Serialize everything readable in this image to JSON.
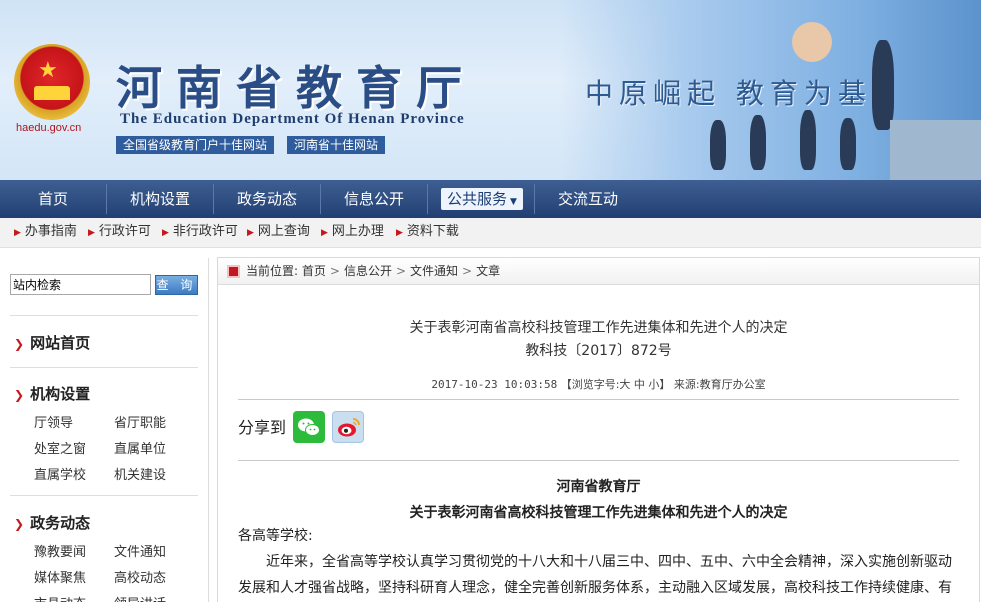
{
  "header": {
    "site_title": "河南省教育厅",
    "site_subtitle": "The Education Department Of Henan Province",
    "domain": "haedu.gov.cn",
    "awards": [
      "全国省级教育门户十佳网站",
      "河南省十佳网站"
    ],
    "slogan": "中原崛起  教育为基"
  },
  "main_nav": {
    "items": [
      "首页",
      "机构设置",
      "政务动态",
      "信息公开",
      "公共服务",
      "交流互动"
    ],
    "active": "公共服务"
  },
  "sub_nav": {
    "items": [
      "办事指南",
      "行政许可",
      "非行政许可",
      "网上查询",
      "网上办理",
      "资料下载"
    ]
  },
  "sidebar": {
    "search_value": "站内检索",
    "search_button": "查 询",
    "sections": [
      {
        "title": "网站首页",
        "links": []
      },
      {
        "title": "机构设置",
        "links": [
          "厅领导",
          "省厅职能",
          "处室之窗",
          "直属单位",
          "直属学校",
          "机关建设"
        ]
      },
      {
        "title": "政务动态",
        "links": [
          "豫教要闻",
          "文件通知",
          "媒体聚焦",
          "高校动态",
          "市县动态",
          "领导讲话"
        ]
      }
    ]
  },
  "breadcrumb": {
    "label": "当前位置:",
    "items": [
      "首页",
      "信息公开",
      "文件通知",
      "文章"
    ]
  },
  "article": {
    "title_line1": "关于表彰河南省高校科技管理工作先进集体和先进个人的决定",
    "title_line2": "教科技〔2017〕872号",
    "date": "2017-10-23 10:03:58",
    "font_label": "【浏览字号:",
    "font_large": "大",
    "font_medium": "中",
    "font_small": "小",
    "font_close": "】",
    "source": "来源:教育厅办公室",
    "share_label": "分享到",
    "issuer": "河南省教育厅",
    "body_title": "关于表彰河南省高校科技管理工作先进集体和先进个人的决定",
    "salutation": "各高等学校:",
    "paragraph": "近年来，全省高等学校认真学习贯彻党的十八大和十八届三中、四中、五中、六中全会精神，深入实施创新驱动发展和人才强省战略，坚持科研育人理念，健全完善创新服务体系，主动融入区域发展，高校科技工作持续健康、有"
  },
  "colors": {
    "nav_blue": "#223f72",
    "accent_red": "#c8161e",
    "title_blue": "#2b4d86"
  }
}
